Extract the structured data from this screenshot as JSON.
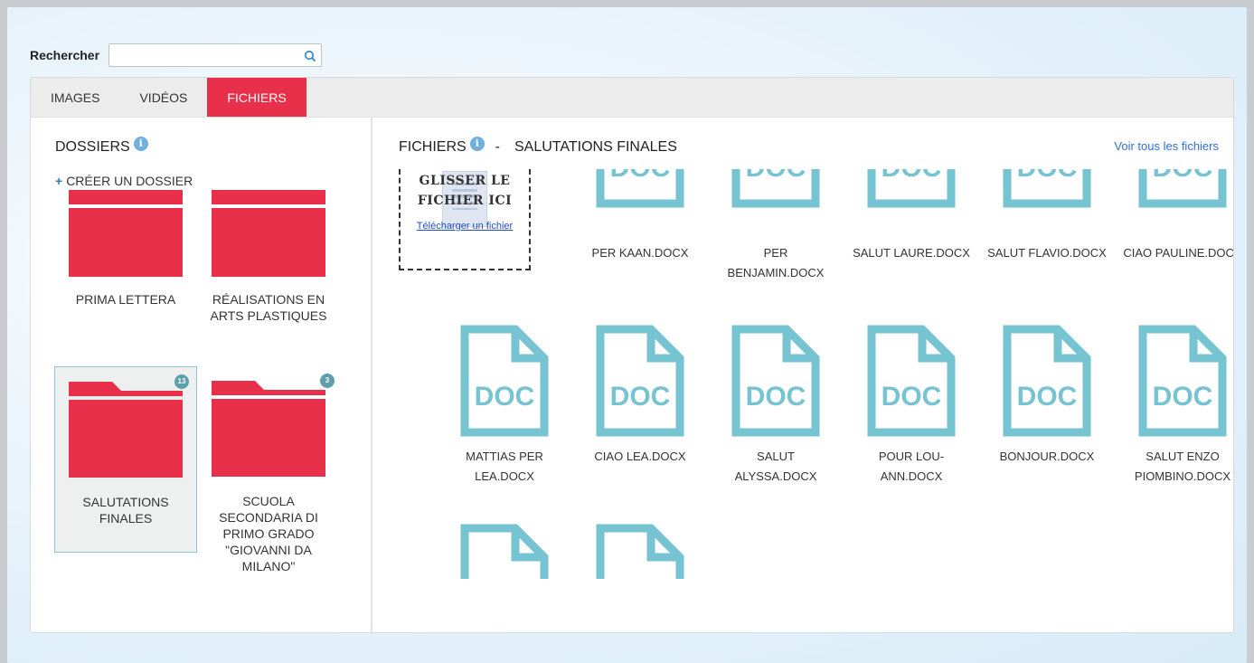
{
  "search": {
    "label": "Rechercher",
    "value": "",
    "placeholder": ""
  },
  "tabs": [
    {
      "label": "IMAGES",
      "active": false
    },
    {
      "label": "VIDÉOS",
      "active": false
    },
    {
      "label": "FICHIERS",
      "active": true
    }
  ],
  "folders_panel": {
    "title": "DOSSIERS",
    "create_label": "CRÉER UN DOSSIER",
    "folders": [
      {
        "name": "PRIMA LETTERA",
        "count": null,
        "selected": false
      },
      {
        "name": "RÉALISATIONS EN ARTS PLASTIQUES",
        "count": null,
        "selected": false
      },
      {
        "name": "SALUTATIONS FINALES",
        "count": "13",
        "selected": true
      },
      {
        "name": "SCUOLA SECONDARIA DI PRIMO GRADO \"GIOVANNI DA MILANO\"",
        "count": "3",
        "selected": false
      }
    ]
  },
  "files_panel": {
    "title": "FICHIERS",
    "separator": "-",
    "folder_name": "SALUTATIONS FINALES",
    "see_all": "Voir tous les fichiers",
    "dropzone": {
      "title": "GLISSER LE FICHIER ICI",
      "upload_link": "Télécharger un fichier"
    },
    "icon_label": "DOC",
    "files": [
      "PER KAAN.DOCX",
      "PER BENJAMIN.DOCX",
      "SALUT LAURE.DOCX",
      "SALUT FLAVIO.DOCX",
      "CIAO PAULINE.DOCX",
      "MATTIAS PER LEA.DOCX",
      "CIAO LEA.DOCX",
      "SALUT ALYSSA.DOCX",
      "POUR LOU-ANN.DOCX",
      "BONJOUR.DOCX",
      "SALUT ENZO PIOMBINO.DOCX",
      "",
      ""
    ]
  },
  "colors": {
    "accent": "#e9304a",
    "doc_icon": "#76c3d2",
    "link": "#2f6fd6"
  }
}
